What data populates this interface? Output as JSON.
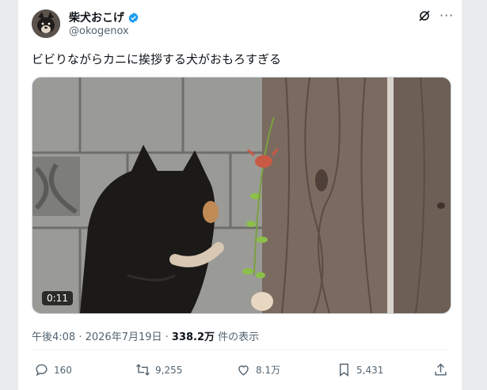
{
  "author": {
    "name": "柴犬おこげ",
    "handle": "@okogenox"
  },
  "tweet": {
    "text": "ビビりながらカニに挨拶する犬がおもろすぎる"
  },
  "media": {
    "duration": "0:11"
  },
  "meta": {
    "time": "午後4:08",
    "date": "2026年7月19日",
    "views": "338.2万",
    "views_label": " 件の表示",
    "sep": " · "
  },
  "actions": {
    "replies": "160",
    "reposts": "9,255",
    "likes": "8.1万",
    "bookmarks": "5,431"
  },
  "colors": {
    "verified": "#1d9bf0",
    "text": "#0f1419",
    "muted": "#536471"
  }
}
